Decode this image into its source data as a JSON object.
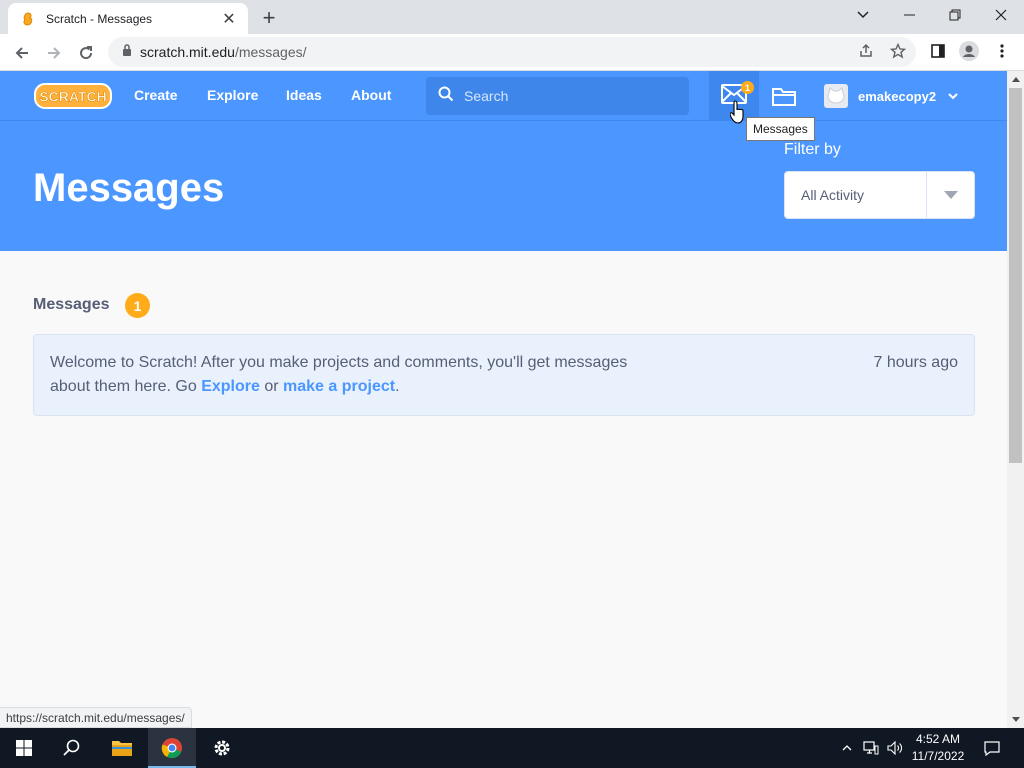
{
  "browser": {
    "tab_title": "Scratch - Messages",
    "url_host": "scratch.mit.edu",
    "url_path": "/messages/",
    "status_url": "https://scratch.mit.edu/messages/"
  },
  "navbar": {
    "logo_text": "SCRATCH",
    "links": [
      "Create",
      "Explore",
      "Ideas",
      "About"
    ],
    "search_placeholder": "Search",
    "message_count": "1",
    "username": "emakecopy2",
    "tooltip": "Messages"
  },
  "header": {
    "title": "Messages",
    "filter_label": "Filter by",
    "filter_value": "All Activity"
  },
  "messages": {
    "section_title": "Messages",
    "count": "1",
    "items": [
      {
        "text_before": "Welcome to Scratch! After you make projects and comments, you'll get messages about them here. Go ",
        "link1": "Explore",
        "text_middle": " or ",
        "link2": "make a project",
        "text_after": ".",
        "time": "7 hours ago"
      }
    ]
  },
  "taskbar": {
    "time": "4:52 AM",
    "date": "11/7/2022"
  },
  "colors": {
    "scratch_blue": "#4c97ff",
    "badge_orange": "#ffab1a",
    "message_bg": "#e9f1fc"
  }
}
